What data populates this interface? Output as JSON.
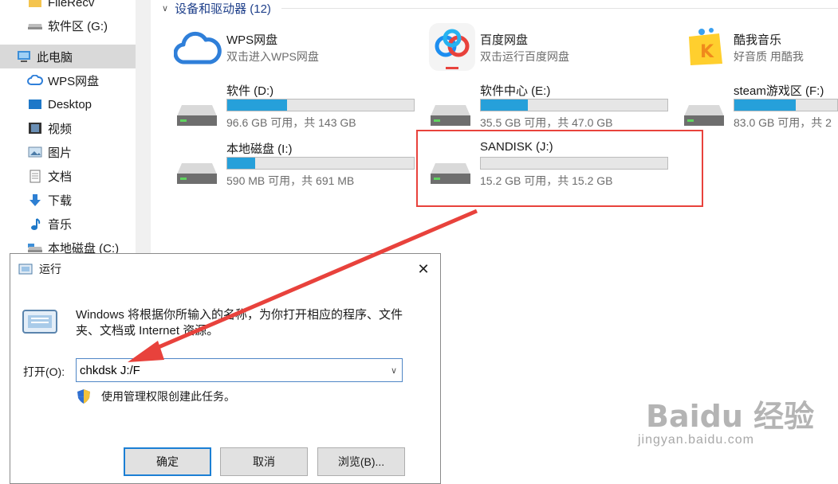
{
  "sidebar": {
    "items": [
      {
        "label": "FileRecv",
        "icon": "folder-icon"
      },
      {
        "label": "软件区 (G:)",
        "icon": "drive-icon"
      },
      {
        "label": "此电脑",
        "icon": "computer-icon",
        "selected": true
      },
      {
        "label": "WPS网盘",
        "icon": "cloud-icon"
      },
      {
        "label": "Desktop",
        "icon": "desktop-icon"
      },
      {
        "label": "视频",
        "icon": "video-icon"
      },
      {
        "label": "图片",
        "icon": "picture-icon"
      },
      {
        "label": "文档",
        "icon": "document-icon"
      },
      {
        "label": "下载",
        "icon": "download-icon"
      },
      {
        "label": "音乐",
        "icon": "music-icon"
      },
      {
        "label": "本地磁盘 (C:)",
        "icon": "drive-icon"
      }
    ]
  },
  "main": {
    "group_header": "设备和驱动器 (12)",
    "apps": [
      {
        "title": "WPS网盘",
        "subtitle": "双击进入WPS网盘",
        "icon": "wps-cloud-icon"
      },
      {
        "title": "百度网盘",
        "subtitle": "双击运行百度网盘",
        "icon": "baidu-netdisk-icon"
      },
      {
        "title": "酷我音乐",
        "subtitle": "好音质 用酷我",
        "icon": "kuwo-music-icon"
      }
    ],
    "drives": [
      {
        "name": "软件 (D:)",
        "space": "96.6 GB 可用，共 143 GB",
        "used_fraction": 0.32
      },
      {
        "name": "软件中心 (E:)",
        "space": "35.5 GB 可用，共 47.0 GB",
        "used_fraction": 0.25
      },
      {
        "name": "steam游戏区 (F:)",
        "space": "83.0 GB 可用，共 2",
        "used_fraction": 0.6
      },
      {
        "name": "本地磁盘 (I:)",
        "space": "590 MB 可用，共 691 MB",
        "used_fraction": 0.15
      },
      {
        "name": "SANDISK (J:)",
        "space": "15.2 GB 可用，共 15.2 GB",
        "used_fraction": 0.0
      }
    ]
  },
  "run_dialog": {
    "title": "运行",
    "close": "✕",
    "description": "Windows 将根据你所输入的名称，为你打开相应的程序、文件夹、文档或 Internet 资源。",
    "open_label": "打开(O):",
    "command_value": "chkdsk J:/F",
    "admin_text": "使用管理权限创建此任务。",
    "buttons": {
      "ok": "确定",
      "cancel": "取消",
      "browse": "浏览(B)..."
    }
  },
  "watermark": {
    "logo": "Baidu 经验",
    "url": "jingyan.baidu.com"
  },
  "colors": {
    "accent": "#26a0da",
    "highlight": "#e8423c",
    "arrow": "#e8423c",
    "selected_bg": "#d9d9d9"
  }
}
